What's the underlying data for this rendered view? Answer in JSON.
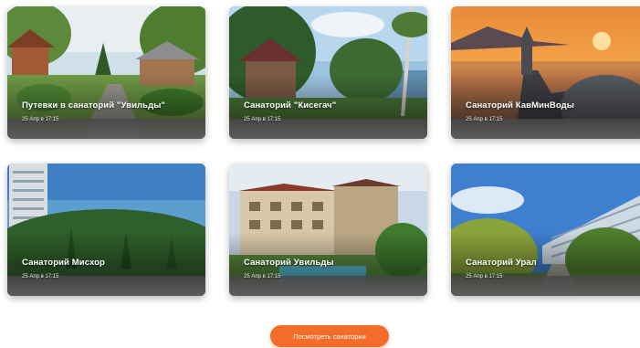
{
  "cards": [
    {
      "title": "Путевки в санаторий \"Увильды\"",
      "date": "25 Апр в 17:15"
    },
    {
      "title": "Санаторий \"Кисегач\"",
      "date": "25 Апр в 17:15"
    },
    {
      "title": "Санаторий КавМинВоды",
      "date": "25 Апр в 17:15"
    },
    {
      "title": "Санаторий Мисхор",
      "date": "25 Апр в 17:15"
    },
    {
      "title": "Санаторий Увильды",
      "date": "25 Апр в 17:15"
    },
    {
      "title": "Санаторий Урал",
      "date": "25 Апр в 17:15"
    }
  ],
  "cta": {
    "label": "Посмотреть санатории"
  },
  "colors": {
    "accent": "#f36c2a"
  }
}
